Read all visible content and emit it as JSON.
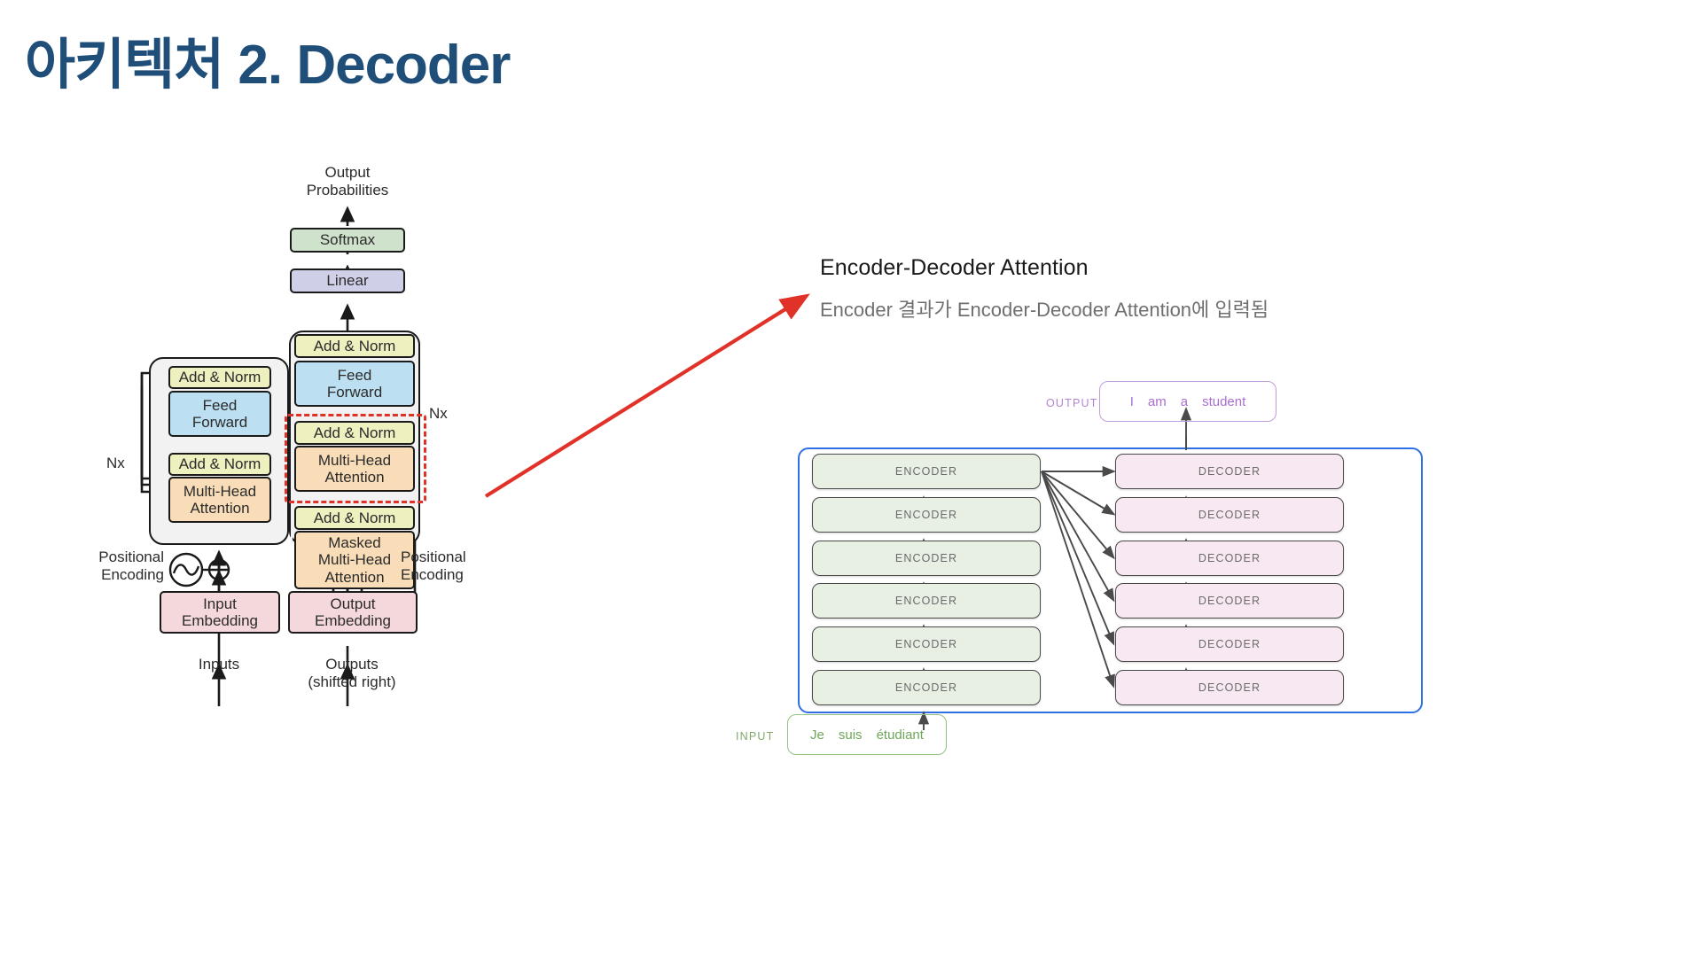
{
  "slide": {
    "title": "아키텍처 2. Decoder",
    "title_color": "#1f4e79"
  },
  "callout": {
    "heading": "Encoder-Decoder Attention",
    "subtext": "Encoder 결과가 Encoder-Decoder Attention에 입력됨",
    "arrow_color": "#e03228"
  },
  "transformer_figure": {
    "top_label": "Output\nProbabilities",
    "softmax": "Softmax",
    "linear": "Linear",
    "encoder_column": {
      "nx": "Nx",
      "add_norm_top": "Add & Norm",
      "feed_forward": "Feed\nForward",
      "add_norm_bottom": "Add & Norm",
      "attention": "Multi-Head\nAttention",
      "positional_encoding": "Positional\nEncoding",
      "embedding": "Input\nEmbedding",
      "bottom_label": "Inputs"
    },
    "decoder_column": {
      "nx": "Nx",
      "add_norm_top": "Add & Norm",
      "feed_forward": "Feed\nForward",
      "add_norm_mid": "Add & Norm",
      "cross_attention": "Multi-Head\nAttention",
      "add_norm_bottom": "Add & Norm",
      "masked_attention": "Masked\nMulti-Head\nAttention",
      "positional_encoding": "Positional\nEncoding",
      "embedding": "Output\nEmbedding",
      "bottom_label": "Outputs\n(shifted right)"
    },
    "highlight_target": "Multi-Head Attention",
    "colors": {
      "softmax": "#cfe3cc",
      "linear": "#cfcfe8",
      "add_norm": "#eef0c0",
      "feed_forward": "#bcdff1",
      "attention": "#f8ddb8",
      "embedding": "#f5d8dc",
      "stack_background": "#f2f2f2"
    }
  },
  "encoder_decoder_figure": {
    "output_label": "OUTPUT",
    "output_tokens": [
      "I",
      "am",
      "a",
      "student"
    ],
    "input_label": "INPUT",
    "input_tokens": [
      "Je",
      "suis",
      "étudiant"
    ],
    "encoder_label": "ENCODER",
    "decoder_label": "DECODER",
    "encoder_count": 6,
    "decoder_count": 6,
    "colors": {
      "encoder_fill": "#e7f0e2",
      "decoder_fill": "#f7e8f1",
      "outer_border": "#2f6fe4",
      "output_accent": "#a86fd0",
      "input_accent": "#6fa75a"
    }
  }
}
